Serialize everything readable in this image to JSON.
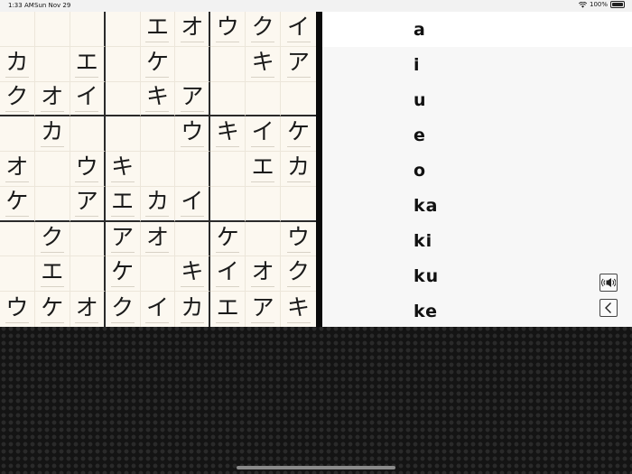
{
  "status": {
    "time": "1:33 AM",
    "date": "Sun Nov 29",
    "battery": "100%"
  },
  "board": [
    [
      "",
      "",
      "",
      "",
      "エ",
      "オ",
      "ウ",
      "ク",
      "イ"
    ],
    [
      "カ",
      "",
      "エ",
      "",
      "ケ",
      "",
      "",
      "キ",
      "ア"
    ],
    [
      "ク",
      "オ",
      "イ",
      "",
      "キ",
      "ア",
      "",
      "",
      ""
    ],
    [
      "",
      "カ",
      "",
      "",
      "",
      "ウ",
      "キ",
      "イ",
      "ケ"
    ],
    [
      "オ",
      "",
      "ウ",
      "キ",
      "",
      "",
      "",
      "エ",
      "カ"
    ],
    [
      "ケ",
      "",
      "ア",
      "エ",
      "カ",
      "イ",
      "",
      "",
      ""
    ],
    [
      "",
      "ク",
      "",
      "ア",
      "オ",
      "",
      "ケ",
      "",
      "ウ"
    ],
    [
      "",
      "エ",
      "",
      "ケ",
      "",
      "キ",
      "イ",
      "オ",
      "ク"
    ],
    [
      "ウ",
      "ケ",
      "オ",
      "ク",
      "イ",
      "カ",
      "エ",
      "ア",
      "キ"
    ]
  ],
  "romaji": {
    "items": [
      "a",
      "i",
      "u",
      "e",
      "o",
      "ka",
      "ki",
      "ku",
      "ke"
    ],
    "selected": "a"
  },
  "controls": {
    "sound_icon": "speaker-icon",
    "back_icon": "chevron-left-icon"
  }
}
